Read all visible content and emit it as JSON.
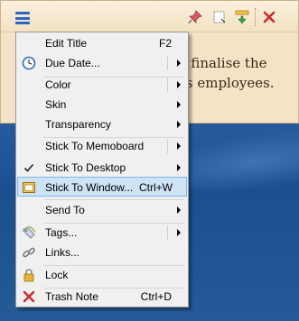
{
  "note": {
    "text_lines": [
      "d finalise the",
      "es employees."
    ]
  },
  "menu": {
    "items": [
      {
        "label": "Edit Title",
        "shortcut": "F2"
      },
      {
        "label": "Due Date..."
      },
      {
        "label": "Color"
      },
      {
        "label": "Skin"
      },
      {
        "label": "Transparency"
      },
      {
        "label": "Stick To Memoboard"
      },
      {
        "label": "Stick To Desktop"
      },
      {
        "label": "Stick To Window...",
        "shortcut": "Ctrl+W"
      },
      {
        "label": "Send To"
      },
      {
        "label": "Tags..."
      },
      {
        "label": "Links..."
      },
      {
        "label": "Lock"
      },
      {
        "label": "Trash Note",
        "shortcut": "Ctrl+D"
      }
    ]
  },
  "colors": {
    "highlight": "#cde3f6",
    "note_bg": "#f4e3c4",
    "menu_bg": "#f0f0f0"
  }
}
